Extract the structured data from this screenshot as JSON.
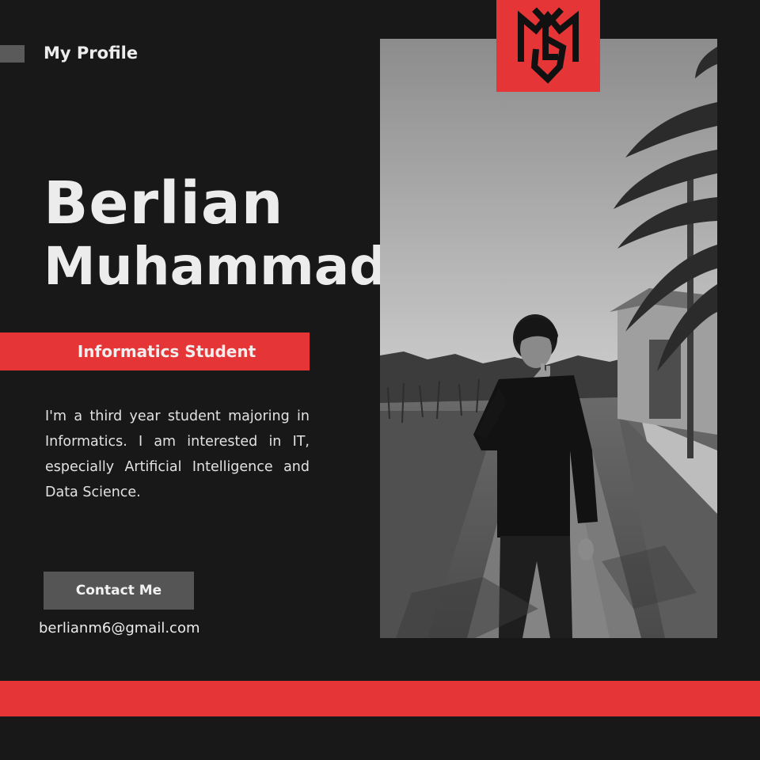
{
  "header": {
    "title": "My Profile"
  },
  "profile": {
    "first_name": "Berlian",
    "last_name": "Muhammad",
    "role": "Informatics Student",
    "bio": "I'm a third year student majoring in Informatics. I am interested in IT, especially Artificial Intelligence and Data Science.",
    "contact_label": "Contact Me",
    "email": "berlianm6@gmail.com"
  },
  "theme": {
    "accent": "#e63536",
    "background": "#181818",
    "button": "#555555",
    "text": "#ececec"
  },
  "icons": {
    "logo": "bm-monogram-logo"
  }
}
